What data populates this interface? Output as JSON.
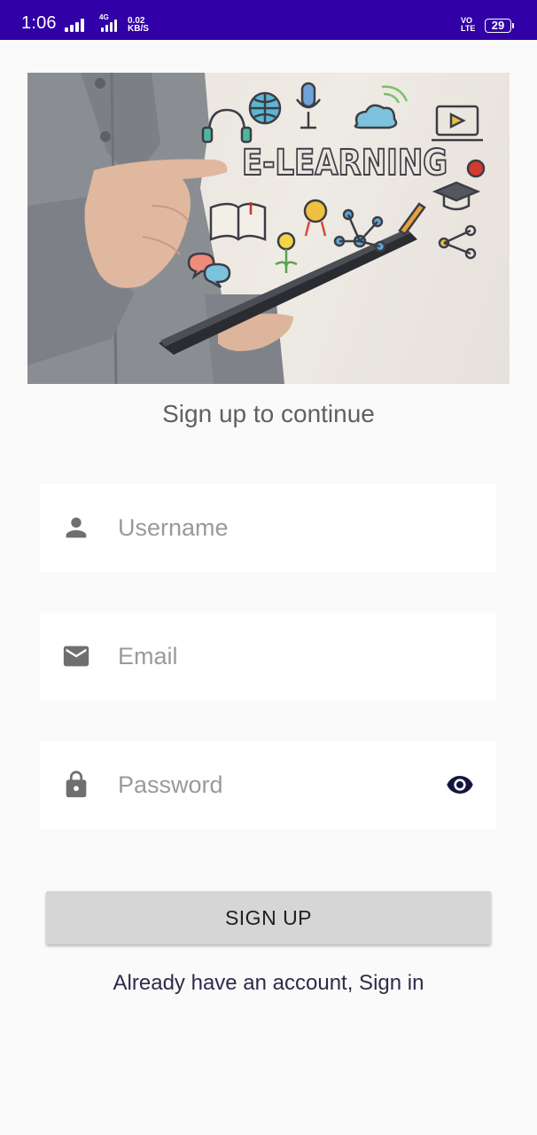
{
  "status_bar": {
    "time": "1:06",
    "network_type": "4G",
    "speed_value": "0.02",
    "speed_unit": "KB/S",
    "volte_top": "VO",
    "volte_bottom": "LTE",
    "battery_level": "29",
    "background_color": "#3100a6"
  },
  "hero": {
    "title": "E-LEARNING"
  },
  "subtitle": "Sign up to continue",
  "form": {
    "username": {
      "placeholder": "Username",
      "value": "",
      "icon": "person-icon"
    },
    "email": {
      "placeholder": "Email",
      "value": "",
      "icon": "mail-icon"
    },
    "password": {
      "placeholder": "Password",
      "value": "",
      "icon": "lock-icon",
      "toggle_icon": "eye-icon"
    }
  },
  "signup_button": {
    "label": "SIGN UP",
    "color": "#d6d6d6"
  },
  "signin_link": {
    "label": "Already have an account, Sign in",
    "color": "#2c2c4a"
  },
  "colors": {
    "icon_gray": "#6f6f6f",
    "eye_icon": "#15163f"
  }
}
